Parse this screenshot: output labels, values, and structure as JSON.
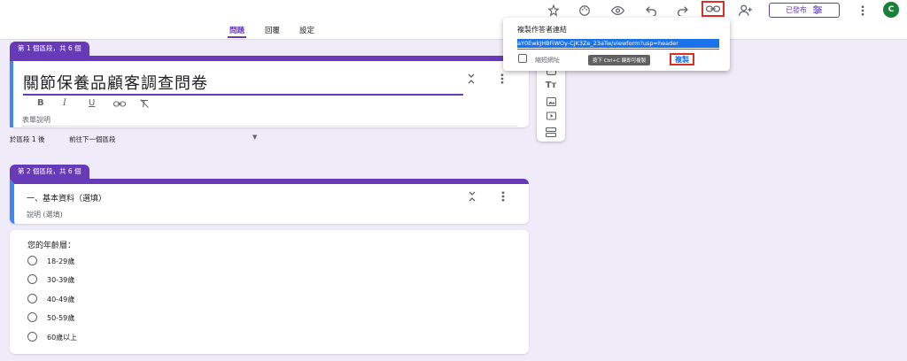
{
  "tabs": [
    {
      "label": "問題",
      "active": true
    },
    {
      "label": "回覆",
      "active": false
    },
    {
      "label": "設定",
      "active": false
    }
  ],
  "header": {
    "published_label": "已發布",
    "avatar_letter": "C",
    "icons": [
      "customize-theme-icon",
      "palette-icon",
      "preview-eye-icon",
      "undo-icon",
      "redo-icon",
      "link-icon",
      "add-collaborator-icon",
      "publish-settings-icon",
      "more-vert-icon"
    ]
  },
  "share_popup": {
    "title": "複製作答者連結",
    "url": "aY0EwkJHBFiWOy-CjK3Ze_23aTw/viewform?usp=header",
    "shorten_label": "縮短網址",
    "tooltip": "按下 Ctrl+C 鍵即可複製",
    "copy_label": "複製"
  },
  "side_toolbar": {
    "icons": [
      "add-question-icon",
      "title-text-icon",
      "image-icon",
      "video-icon",
      "section-icon"
    ],
    "text_label": "Tт"
  },
  "section1": {
    "tab_label": "第 1 個區段，共 6 個",
    "form_title": "關節保養品顧客調查問卷",
    "format_buttons": [
      "B",
      "I",
      "U"
    ],
    "description_placeholder": "表單說明",
    "after_section_label": "於區段 1 後",
    "after_section_value": "前往下一個區段"
  },
  "section2": {
    "tab_label": "第 2 個區段，共 6 個",
    "title": "一、基本資料（選填）",
    "description_placeholder": "說明 (選填)"
  },
  "question": {
    "title": "您的年齡層：",
    "options": [
      "18-29歲",
      "30-39歲",
      "40-49歲",
      "50-59歲",
      "60歲以上"
    ]
  }
}
